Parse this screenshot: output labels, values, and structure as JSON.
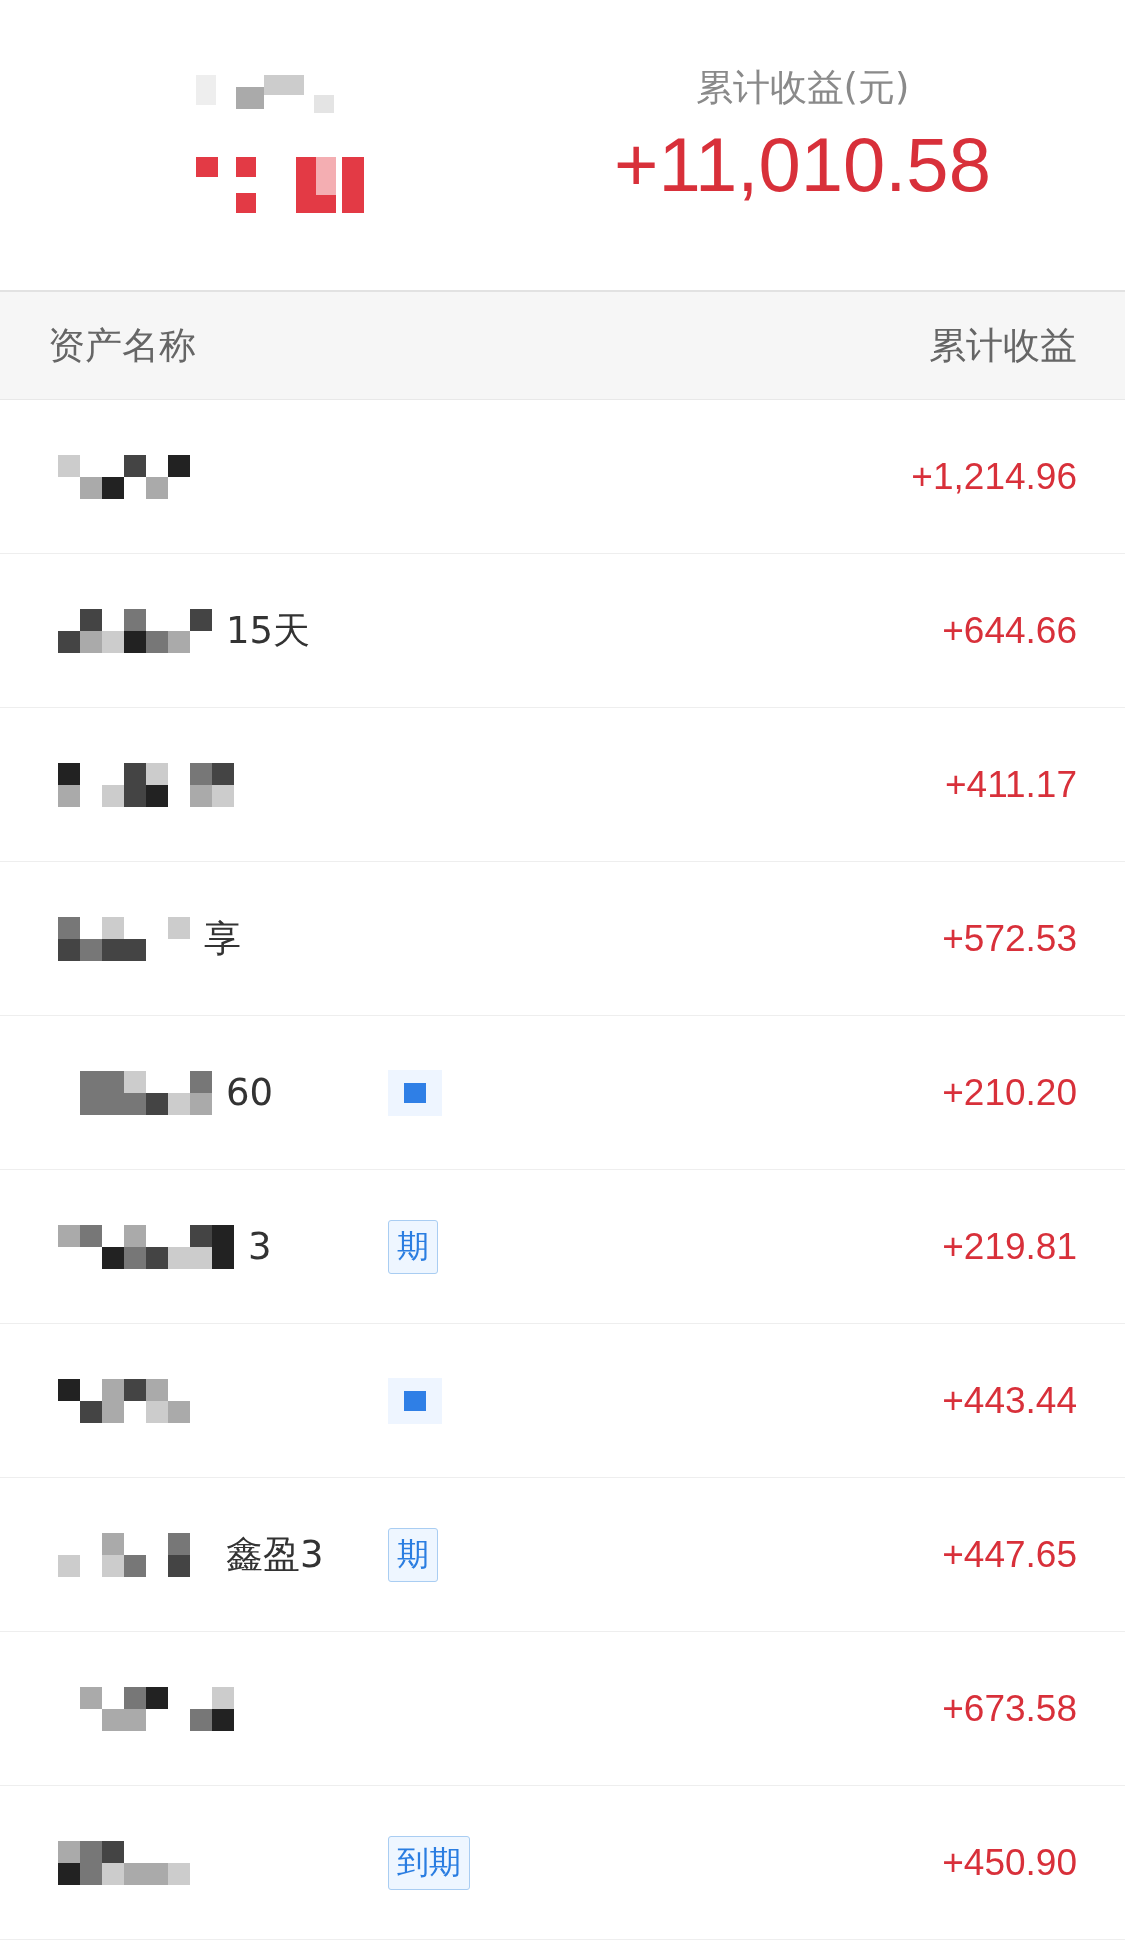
{
  "summary": {
    "title": "累计收益(元)",
    "value": "+11,010.58"
  },
  "table": {
    "columns": [
      "资产名称",
      "累计收益"
    ],
    "rows": [
      {
        "name": "",
        "value": "+1,214.96"
      },
      {
        "name": "15天",
        "value": "+644.66"
      },
      {
        "name": "",
        "value": "+411.17"
      },
      {
        "name": "享",
        "value": "+572.53"
      },
      {
        "name": "60",
        "value": "+210.20",
        "tag": {
          "kind": "masked"
        }
      },
      {
        "name": "3",
        "value": "+219.81",
        "tag": {
          "kind": "text",
          "text": "期"
        }
      },
      {
        "name": "",
        "value": "+443.44",
        "tag": {
          "kind": "masked"
        }
      },
      {
        "name": "鑫盈3",
        "value": "+447.65",
        "tag": {
          "kind": "text",
          "text": "期"
        }
      },
      {
        "name": "",
        "value": "+673.58"
      },
      {
        "name": "",
        "value": "+450.90",
        "tag": {
          "kind": "text",
          "text": "到期"
        }
      }
    ]
  }
}
